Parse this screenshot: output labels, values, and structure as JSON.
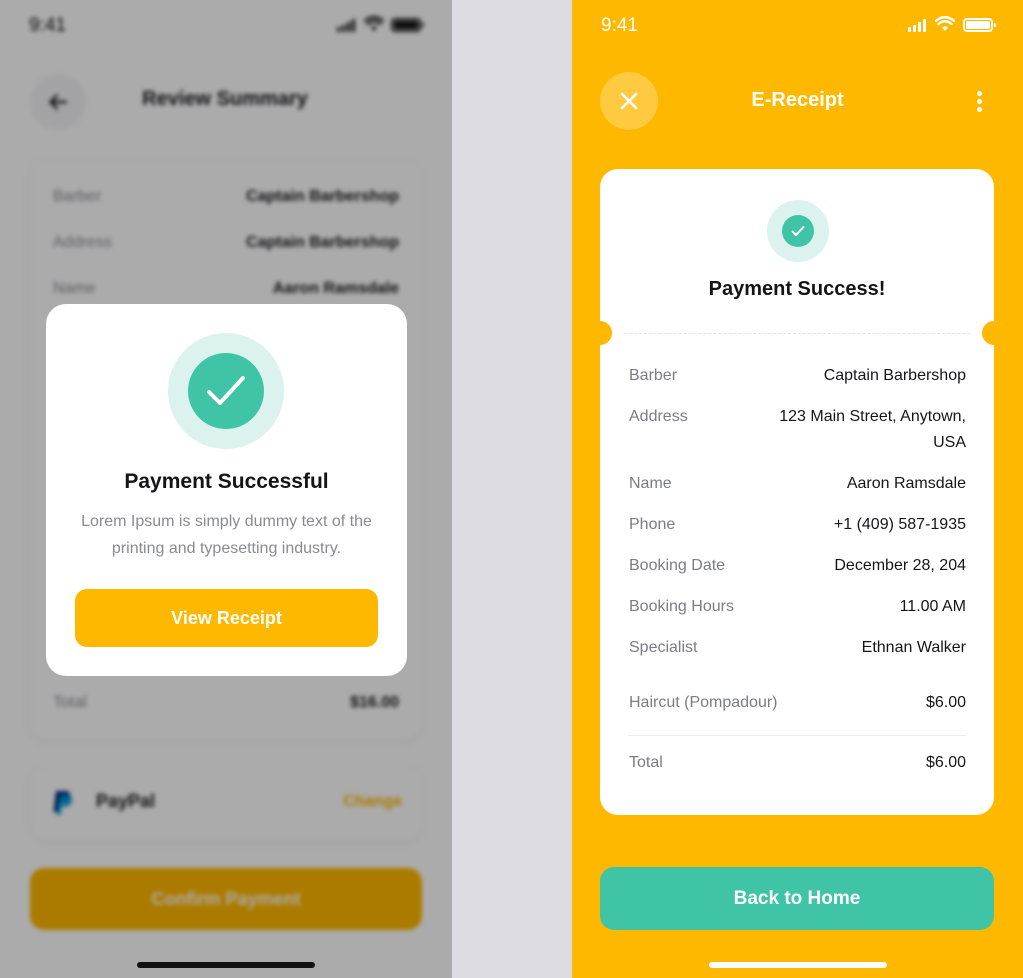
{
  "colors": {
    "accent": "#FFB800",
    "success": "#3FC4A6",
    "success_soft": "#DCF2EE",
    "text_primary": "#151518",
    "text_secondary": "#8A8A93"
  },
  "left_screen": {
    "status_bar": {
      "time": "9:41"
    },
    "header": {
      "title": "Review Summary"
    },
    "summary_rows": [
      {
        "label": "Barber",
        "value": "Captain Barbershop"
      },
      {
        "label": "Address",
        "value": "Captain Barbershop"
      },
      {
        "label": "Name",
        "value": "Aaron Ramsdale"
      }
    ],
    "total": {
      "label": "Total",
      "value": "$16.00"
    },
    "payment": {
      "method": "PayPal",
      "change_label": "Change"
    },
    "confirm_label": "Confirm Payment",
    "modal": {
      "title": "Payment Successful",
      "message": "Lorem Ipsum is simply dummy text of the printing and typesetting industry.",
      "button_label": "View Receipt"
    }
  },
  "right_screen": {
    "status_bar": {
      "time": "9:41"
    },
    "header": {
      "title": "E-Receipt"
    },
    "receipt": {
      "title": "Payment Success!",
      "rows": [
        {
          "label": "Barber",
          "value": "Captain Barbershop"
        },
        {
          "label": "Address",
          "value": "123 Main Street, Anytown, USA"
        },
        {
          "label": "Name",
          "value": "Aaron Ramsdale"
        },
        {
          "label": "Phone",
          "value": "+1 (409) 587-1935"
        },
        {
          "label": "Booking Date",
          "value": "December 28, 204"
        },
        {
          "label": "Booking Hours",
          "value": "11.00 AM"
        },
        {
          "label": "Specialist",
          "value": "Ethnan Walker"
        }
      ],
      "service": {
        "label": "Haircut (Pompadour)",
        "value": "$6.00"
      },
      "total": {
        "label": "Total",
        "value": "$6.00"
      }
    },
    "home_button_label": "Back to Home"
  }
}
